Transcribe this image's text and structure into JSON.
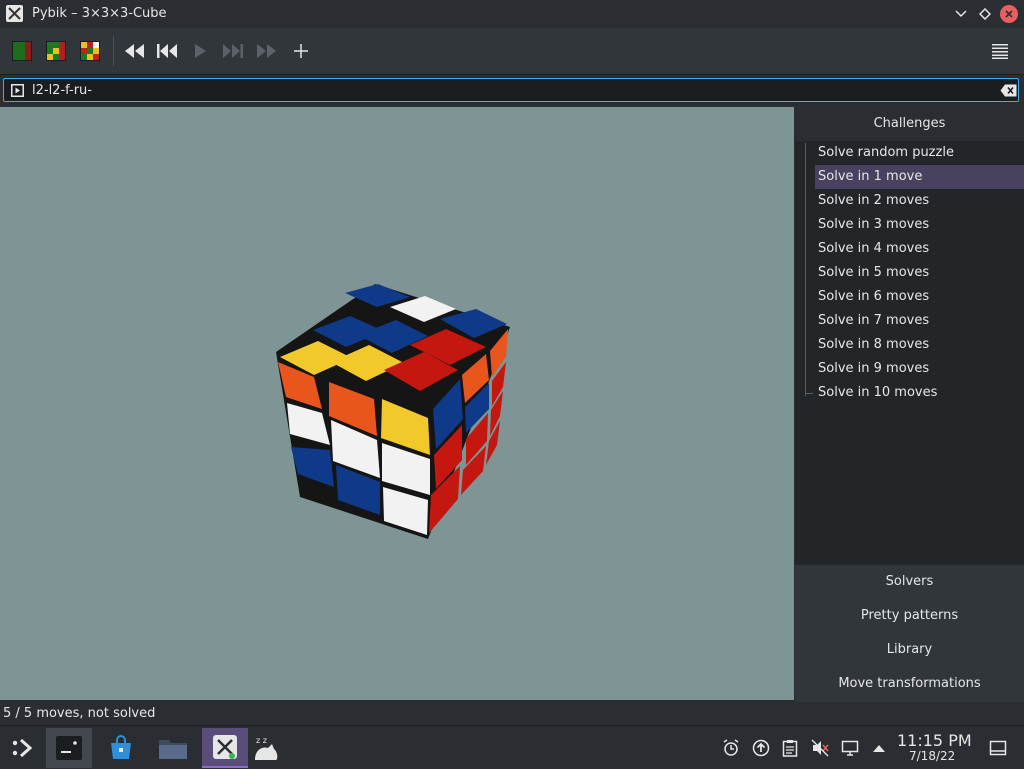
{
  "window": {
    "title": "Pybik – 3×3×3-Cube"
  },
  "moves": {
    "value": "l2-l2-f-ru-"
  },
  "sidebar": {
    "header": "Challenges",
    "items": [
      "Solve random puzzle",
      "Solve in 1 move",
      "Solve in 2 moves",
      "Solve in 3 moves",
      "Solve in 4 moves",
      "Solve in 5 moves",
      "Solve in 6 moves",
      "Solve in 7 moves",
      "Solve in 8 moves",
      "Solve in 9 moves",
      "Solve in 10 moves"
    ],
    "selected_index": 1,
    "tabs": [
      "Solvers",
      "Pretty patterns",
      "Library",
      "Move transformations"
    ]
  },
  "status": {
    "text": "5 / 5 moves, not solved"
  },
  "clock": {
    "time": "11:15 PM",
    "date": "7/18/22"
  },
  "cube": {
    "colors": {
      "blue": "#0f3a8a",
      "white": "#f2f2f2",
      "yellow": "#f2c92a",
      "orange": "#e8561e",
      "red": "#c4170f"
    }
  }
}
